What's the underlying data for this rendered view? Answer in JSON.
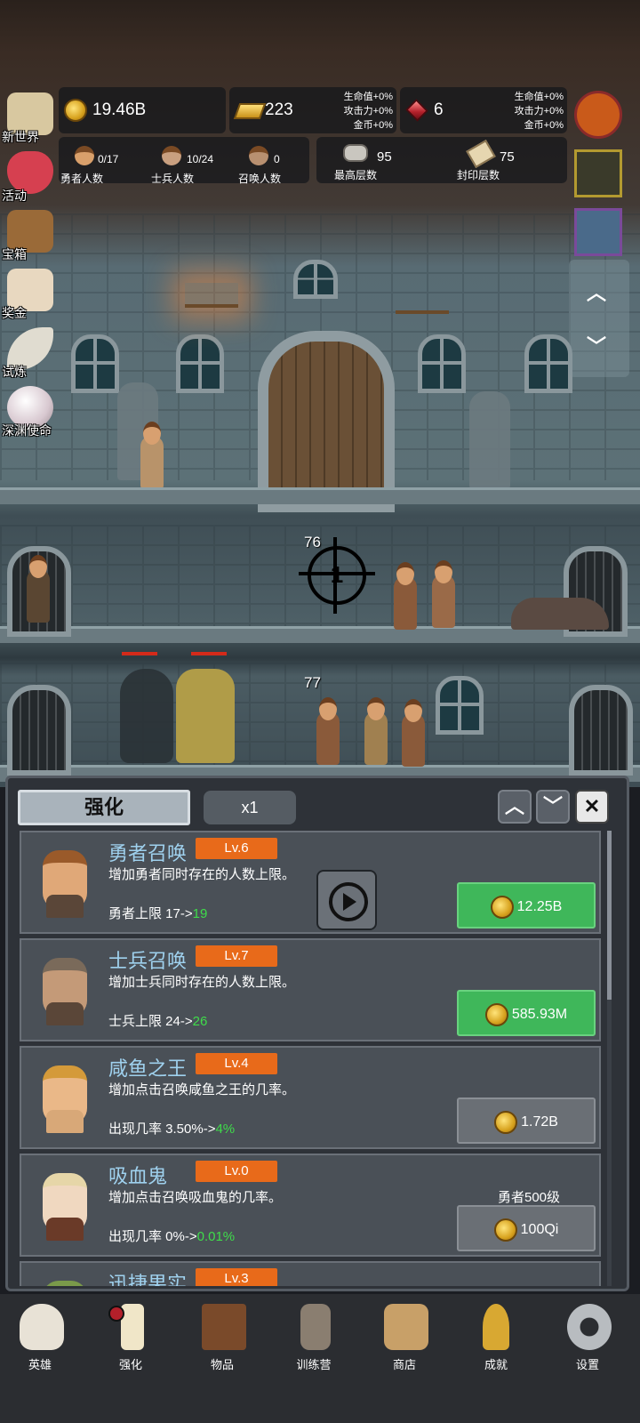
{
  "top_bar": {
    "gold": "19.46B",
    "gold_bars": "223",
    "gems": "6",
    "buff1": [
      "生命值+0%",
      "攻击力+0%",
      "金币+0%"
    ],
    "buff2": [
      "生命值+0%",
      "攻击力+0%",
      "金币+0%"
    ],
    "hero_count": "0/17",
    "hero_label": "勇者人数",
    "soldier_count": "10/24",
    "soldier_label": "士兵人数",
    "summon_count": "0",
    "summon_label": "召唤人数",
    "max_floor": "95",
    "max_floor_label": "最高层数",
    "seal_floor": "75",
    "seal_floor_label": "封印层数"
  },
  "left_menu": [
    {
      "label": "新世界",
      "icon": "map-icon"
    },
    {
      "label": "活动",
      "icon": "heart-icon"
    },
    {
      "label": "宝箱",
      "icon": "chest-icon"
    },
    {
      "label": "奖金",
      "icon": "envelope-icon"
    },
    {
      "label": "试炼",
      "icon": "feather-icon"
    },
    {
      "label": "深渊使命",
      "icon": "pearl-icon"
    }
  ],
  "scene": {
    "floor_a": "76",
    "floor_b": "77",
    "target_number": "1"
  },
  "panel": {
    "tab_title": "强化",
    "multiplier": "x1",
    "items": [
      {
        "name": "勇者召唤",
        "level": "Lv.6",
        "desc": "增加勇者同时存在的人数上限。",
        "effect_base": "勇者上限 17->",
        "effect_next": "19",
        "price": "12.25B",
        "buy_state": "green"
      },
      {
        "name": "士兵召唤",
        "level": "Lv.7",
        "desc": "增加士兵同时存在的人数上限。",
        "effect_base": "士兵上限 24->",
        "effect_next": "26",
        "price": "585.93M",
        "buy_state": "green"
      },
      {
        "name": "咸鱼之王",
        "level": "Lv.4",
        "desc": "增加点击召唤咸鱼之王的几率。",
        "effect_base": "出现几率 3.50%->",
        "effect_next": "4%",
        "price": "1.72B",
        "buy_state": "gray"
      },
      {
        "name": "吸血鬼",
        "level": "Lv.0",
        "desc": "增加点击召唤吸血鬼的几率。",
        "effect_base": "出现几率 0%->",
        "effect_next": "0.01%",
        "price": "100Qi",
        "requirement": "勇者500级",
        "buy_state": "gray"
      },
      {
        "name": "迅捷果实",
        "level": "Lv.3"
      }
    ]
  },
  "bottom_nav": [
    {
      "label": "英雄",
      "icon": "skull-icon"
    },
    {
      "label": "强化",
      "icon": "candle-icon"
    },
    {
      "label": "物品",
      "icon": "book-icon"
    },
    {
      "label": "训练营",
      "icon": "lantern-icon"
    },
    {
      "label": "商店",
      "icon": "beer-mug-icon"
    },
    {
      "label": "成就",
      "icon": "key-icon"
    },
    {
      "label": "设置",
      "icon": "gear-icon"
    }
  ]
}
